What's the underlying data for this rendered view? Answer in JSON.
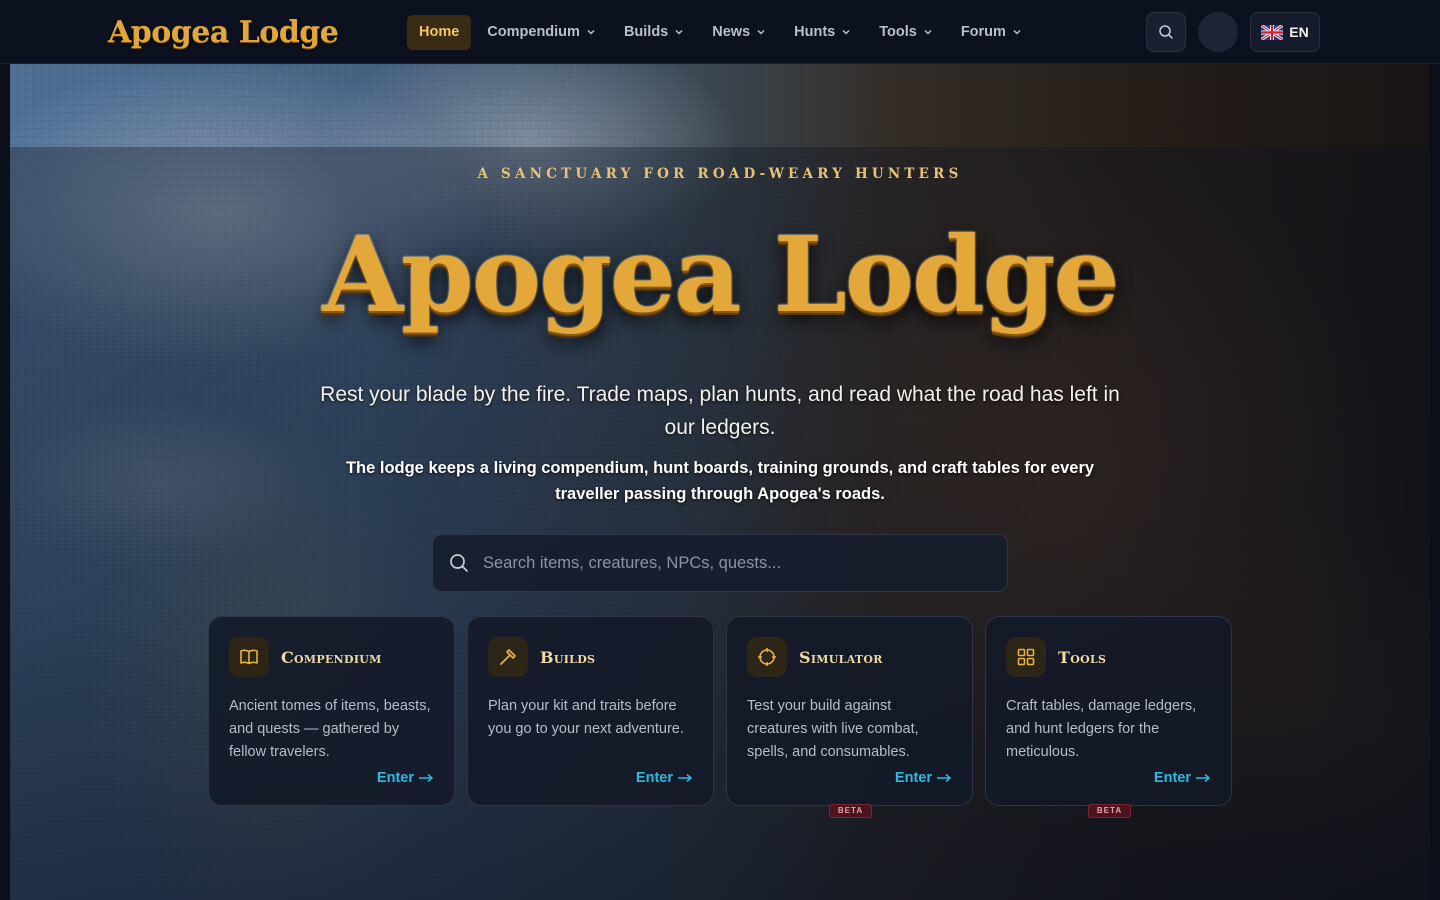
{
  "header": {
    "logo_text": "Apogea Lodge",
    "nav": [
      {
        "label": "Home",
        "active": true,
        "dropdown": false
      },
      {
        "label": "Compendium",
        "active": false,
        "dropdown": true
      },
      {
        "label": "Builds",
        "active": false,
        "dropdown": true
      },
      {
        "label": "News",
        "active": false,
        "dropdown": true
      },
      {
        "label": "Hunts",
        "active": false,
        "dropdown": true
      },
      {
        "label": "Tools",
        "active": false,
        "dropdown": true
      },
      {
        "label": "Forum",
        "active": false,
        "dropdown": true
      }
    ],
    "search_icon": "search-icon",
    "language": {
      "code": "EN",
      "flag": "uk-flag-icon"
    }
  },
  "hero": {
    "tagline": "A sanctuary for road-weary hunters",
    "title": "Apogea Lodge",
    "lead": "Rest your blade by the fire. Trade maps, plan hunts, and read what the road has left in our ledgers.",
    "sub": "The lodge keeps a living compendium, hunt boards, training grounds, and craft tables for every traveller passing through Apogea's roads.",
    "search": {
      "placeholder": "Search items, creatures, NPCs, quests..."
    }
  },
  "cards": [
    {
      "icon": "book-icon",
      "title": "Compendium",
      "desc": "Ancient tomes of items, beasts, and quests — gathered by fellow travelers.",
      "link": "Enter",
      "badge": ""
    },
    {
      "icon": "hammer-icon",
      "title": "Builds",
      "desc": "Plan your kit and traits before you go to your next adventure.",
      "link": "Enter",
      "badge": ""
    },
    {
      "icon": "target-icon",
      "title": "Simulator",
      "desc": "Test your build against creatures with live combat, spells, and consumables.",
      "link": "Enter",
      "badge": "BETA"
    },
    {
      "icon": "grid-icon",
      "title": "Tools",
      "desc": "Craft tables, damage ledgers, and hunt ledgers for the meticulous.",
      "link": "Enter",
      "badge": "BETA"
    }
  ],
  "colors": {
    "accent_gold": "#e3a73a",
    "link_cyan": "#2fb8e0",
    "nav_active_bg": "#3a2c14",
    "badge_red": "#4b1520"
  }
}
